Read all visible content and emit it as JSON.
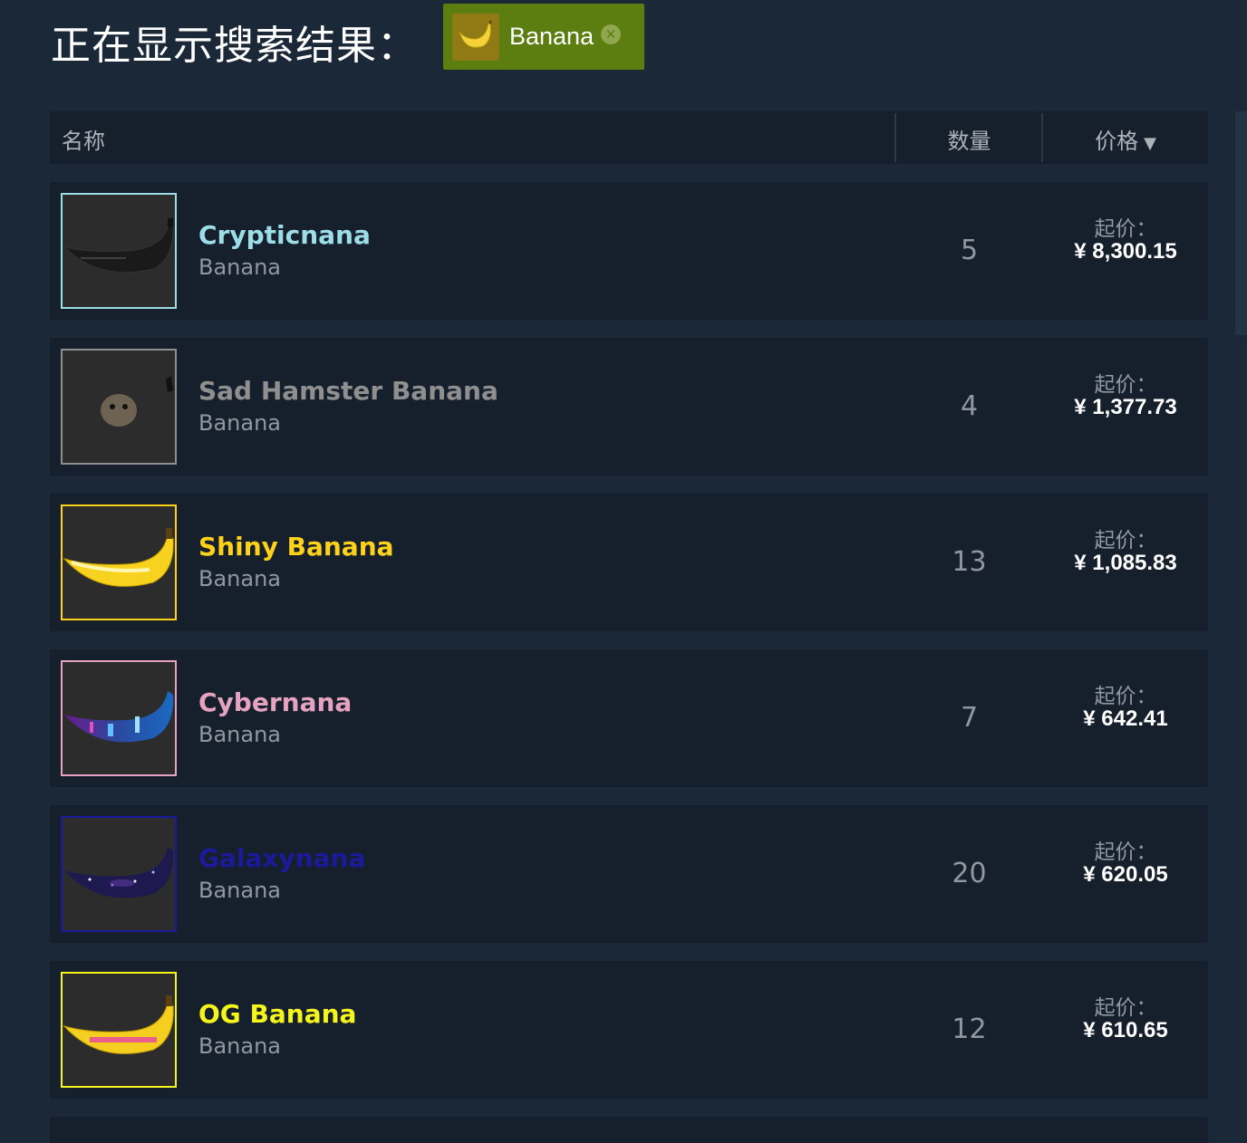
{
  "search": {
    "title": "正在显示搜索结果：",
    "filter_tag": {
      "label": "Banana",
      "icon": "banana-icon",
      "close_icon": "close-icon"
    }
  },
  "table": {
    "headers": {
      "name": "名称",
      "quantity": "数量",
      "price": "价格",
      "sort_icon": "▼"
    },
    "rows": [
      {
        "name": "Crypticnana",
        "game": "Banana",
        "quantity": "5",
        "price_label": "起价：",
        "price": "¥ 8,300.15",
        "name_color": "#9cdde8",
        "border_color": "#9cdde8",
        "image": "black-banana-icon"
      },
      {
        "name": "Sad Hamster Banana",
        "game": "Banana",
        "quantity": "4",
        "price_label": "起价：",
        "price": "¥ 1,377.73",
        "name_color": "#8f8f8f",
        "border_color": "#8f8f8f",
        "image": "hamster-banana-icon"
      },
      {
        "name": "Shiny Banana",
        "game": "Banana",
        "quantity": "13",
        "price_label": "起价：",
        "price": "¥ 1,085.83",
        "name_color": "#ffd21a",
        "border_color": "#ffd21a",
        "image": "shiny-banana-icon"
      },
      {
        "name": "Cybernana",
        "game": "Banana",
        "quantity": "7",
        "price_label": "起价：",
        "price": "¥ 642.41",
        "name_color": "#e5a3c0",
        "border_color": "#e5a3c0",
        "image": "cyber-banana-icon"
      },
      {
        "name": "Galaxynana",
        "game": "Banana",
        "quantity": "20",
        "price_label": "起价：",
        "price": "¥ 620.05",
        "name_color": "#1a1a9a",
        "border_color": "#1a1a9a",
        "image": "galaxy-banana-icon"
      },
      {
        "name": "OG Banana",
        "game": "Banana",
        "quantity": "12",
        "price_label": "起价：",
        "price": "¥ 610.65",
        "name_color": "#f5f51c",
        "border_color": "#f5f51c",
        "image": "og-banana-icon"
      }
    ]
  }
}
